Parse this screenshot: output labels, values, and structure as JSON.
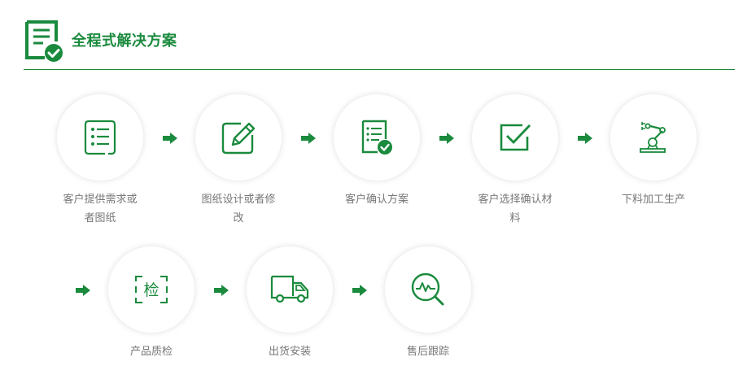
{
  "header": {
    "title": "全程式解决方案",
    "icon": "document-check-icon"
  },
  "colors": {
    "accent": "#1a8a3d"
  },
  "steps_row1": [
    {
      "label": "客户提供需求或者图纸",
      "icon": "list-icon"
    },
    {
      "label": "图纸设计或者修改",
      "icon": "edit-icon"
    },
    {
      "label": "客户确认方案",
      "icon": "document-check-icon"
    },
    {
      "label": "客户选择确认材料",
      "icon": "checkbox-icon"
    },
    {
      "label": "下料加工生产",
      "icon": "robot-arm-icon"
    }
  ],
  "steps_row2": [
    {
      "label": "产品质检",
      "icon": "inspection-icon"
    },
    {
      "label": "出货安装",
      "icon": "truck-icon"
    },
    {
      "label": "售后跟踪",
      "icon": "search-chart-icon"
    }
  ],
  "inspect_char": "检"
}
